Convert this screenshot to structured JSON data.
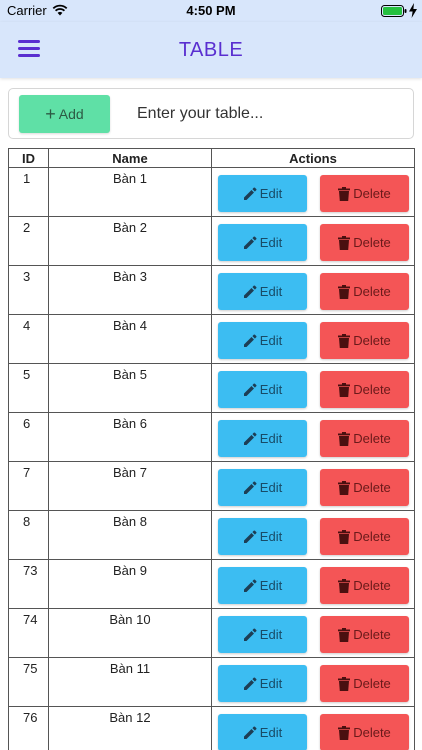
{
  "status_bar": {
    "carrier": "Carrier",
    "time": "4:50 PM"
  },
  "navbar": {
    "title": "TABLE"
  },
  "add_bar": {
    "add_label": "Add",
    "input_placeholder": "Enter your table..."
  },
  "table": {
    "columns": [
      "ID",
      "Name",
      "Actions"
    ],
    "edit_label": "Edit",
    "delete_label": "Delete",
    "rows": [
      {
        "id": "1",
        "name": "Bàn 1"
      },
      {
        "id": "2",
        "name": "Bàn 2"
      },
      {
        "id": "3",
        "name": "Bàn 3"
      },
      {
        "id": "4",
        "name": "Bàn 4"
      },
      {
        "id": "5",
        "name": "Bàn 5"
      },
      {
        "id": "6",
        "name": "Bàn 6"
      },
      {
        "id": "7",
        "name": "Bàn 7"
      },
      {
        "id": "8",
        "name": "Bàn 8"
      },
      {
        "id": "73",
        "name": "Bàn 9"
      },
      {
        "id": "74",
        "name": "Bàn 10"
      },
      {
        "id": "75",
        "name": "Bàn 11"
      },
      {
        "id": "76",
        "name": "Bàn 12"
      }
    ]
  },
  "colors": {
    "accent": "#5a2fd0",
    "header_bg": "#d8e6fb",
    "add": "#5fe0a6",
    "edit": "#3cbdf2",
    "delete": "#f45556"
  },
  "icons": {
    "menu": "hamburger-icon",
    "add": "plus-icon",
    "edit": "pencil-icon",
    "delete": "trash-icon"
  }
}
